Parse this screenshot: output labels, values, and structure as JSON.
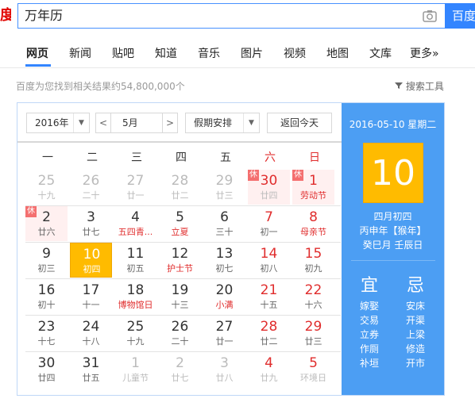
{
  "search": {
    "logo_text": "度",
    "query": "万年历",
    "button_label": "百度一下"
  },
  "tabs": [
    "网页",
    "新闻",
    "贴吧",
    "知道",
    "音乐",
    "图片",
    "视频",
    "地图",
    "文库",
    "更多»"
  ],
  "results": {
    "count_text": "百度为您找到相关结果约54,800,000个",
    "tools_label": "搜索工具"
  },
  "calendar": {
    "year_select": "2016年",
    "month_select": "5月",
    "holiday_select": "假期安排",
    "today_button": "返回今天",
    "prev_label": "<",
    "next_label": ">",
    "arrow_label": "▼",
    "weekdays": [
      "一",
      "二",
      "三",
      "四",
      "五",
      "六",
      "日"
    ],
    "weeks": [
      [
        {
          "d": "25",
          "s": "十九",
          "other": true
        },
        {
          "d": "26",
          "s": "二十",
          "other": true
        },
        {
          "d": "27",
          "s": "廿一",
          "other": true
        },
        {
          "d": "28",
          "s": "廿二",
          "other": true
        },
        {
          "d": "29",
          "s": "廿三",
          "other": true
        },
        {
          "d": "30",
          "s": "廿四",
          "other": true,
          "badge": "休",
          "holiday": true
        },
        {
          "d": "1",
          "s": "劳动节",
          "fest": true,
          "badge": "休",
          "holiday": true
        }
      ],
      [
        {
          "d": "2",
          "s": "廿六",
          "badge": "休",
          "holiday": true
        },
        {
          "d": "3",
          "s": "廿七"
        },
        {
          "d": "4",
          "s": "五四青...",
          "fest": true
        },
        {
          "d": "5",
          "s": "立夏",
          "fest": true
        },
        {
          "d": "6",
          "s": "三十"
        },
        {
          "d": "7",
          "s": "初一"
        },
        {
          "d": "8",
          "s": "母亲节",
          "fest": true
        }
      ],
      [
        {
          "d": "9",
          "s": "初三"
        },
        {
          "d": "10",
          "s": "初四",
          "selected": true
        },
        {
          "d": "11",
          "s": "初五"
        },
        {
          "d": "12",
          "s": "护士节",
          "fest": true
        },
        {
          "d": "13",
          "s": "初七"
        },
        {
          "d": "14",
          "s": "初八"
        },
        {
          "d": "15",
          "s": "初九"
        }
      ],
      [
        {
          "d": "16",
          "s": "初十"
        },
        {
          "d": "17",
          "s": "十一"
        },
        {
          "d": "18",
          "s": "博物馆日",
          "fest": true
        },
        {
          "d": "19",
          "s": "十三"
        },
        {
          "d": "20",
          "s": "小满",
          "fest": true
        },
        {
          "d": "21",
          "s": "十五"
        },
        {
          "d": "22",
          "s": "十六"
        }
      ],
      [
        {
          "d": "23",
          "s": "十七"
        },
        {
          "d": "24",
          "s": "十八"
        },
        {
          "d": "25",
          "s": "十九"
        },
        {
          "d": "26",
          "s": "二十"
        },
        {
          "d": "27",
          "s": "廿一"
        },
        {
          "d": "28",
          "s": "廿二"
        },
        {
          "d": "29",
          "s": "廿三"
        }
      ],
      [
        {
          "d": "30",
          "s": "廿四"
        },
        {
          "d": "31",
          "s": "廿五"
        },
        {
          "d": "1",
          "s": "儿童节",
          "other": true
        },
        {
          "d": "2",
          "s": "廿七",
          "other": true
        },
        {
          "d": "3",
          "s": "廿八",
          "other": true
        },
        {
          "d": "4",
          "s": "廿九",
          "other": true
        },
        {
          "d": "5",
          "s": "环境日",
          "other": true
        }
      ]
    ],
    "side": {
      "date": "2016-05-10 星期二",
      "day": "10",
      "lunar": "四月初四",
      "ganzhi_year": "丙申年【猴年】",
      "ganzhi_month": "癸巳月 壬辰日",
      "yi_label": "宜",
      "ji_label": "忌",
      "yi": [
        "嫁娶",
        "交易",
        "立券",
        "作厕",
        "补垣"
      ],
      "ji": [
        "安床",
        "开渠",
        "上梁",
        "修造",
        "开市"
      ]
    }
  },
  "colors": {
    "accent": "#3385ff",
    "selected": "#ffbb00",
    "side": "#4c9ef3",
    "red": "#e02d2d"
  }
}
